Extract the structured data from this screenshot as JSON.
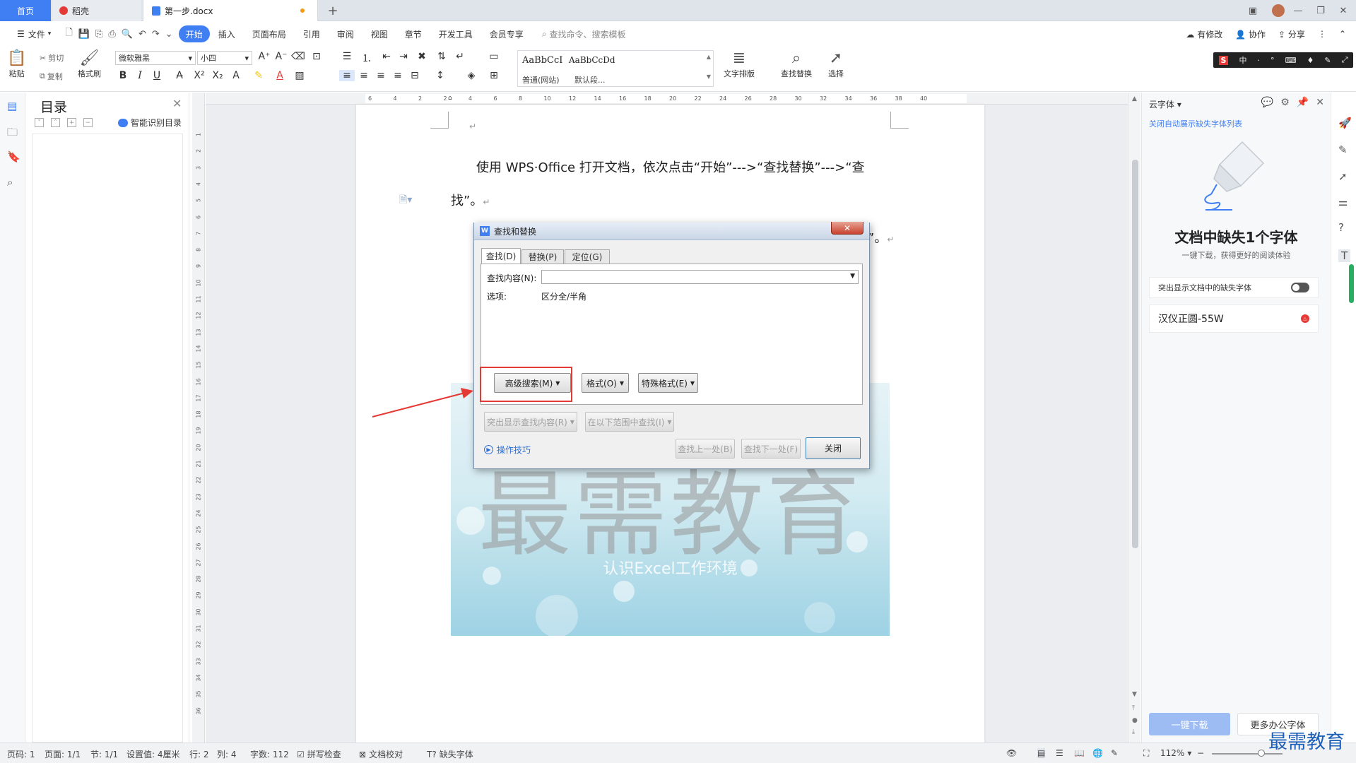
{
  "tabs": {
    "home": "首页",
    "daoke": "稻壳",
    "doc": "第一步.docx",
    "plus": "+",
    "close": "×"
  },
  "menu": {
    "file": "文件",
    "items": [
      "开始",
      "插入",
      "页面布局",
      "引用",
      "审阅",
      "视图",
      "章节",
      "开发工具",
      "会员专享"
    ],
    "search_placeholder": "查找命令、搜索模板",
    "right": [
      "有修改",
      "协作",
      "分享"
    ]
  },
  "ribbon": {
    "paste": "粘贴",
    "cut": "剪切",
    "copy": "复制",
    "format_painter": "格式刷",
    "font_name": "微软雅黑",
    "font_size": "小四",
    "style1_preview": "AaBbCcI",
    "style1_label": "普通(网站)",
    "style2_preview": "AaBbCcDd",
    "style2_label": "默认段...",
    "text_layout": "文字排版",
    "find_replace": "查找替换",
    "select": "选择",
    "ime": [
      "S",
      "中",
      "·",
      "°",
      "⌨",
      "♦",
      "✎",
      "⤢"
    ]
  },
  "toc": {
    "title": "目录",
    "smart": "智能识别目录"
  },
  "ruler": {
    "h_ticks": [
      "6",
      "4",
      "2",
      "2",
      "4",
      "6",
      "8",
      "10",
      "12",
      "14",
      "16",
      "18",
      "20",
      "22",
      "24",
      "26",
      "28",
      "30",
      "32",
      "34",
      "36",
      "38",
      "40"
    ],
    "v_ticks": [
      "1",
      "2",
      "3",
      "4",
      "5",
      "6",
      "7",
      "8",
      "9",
      "10",
      "11",
      "12",
      "13",
      "14",
      "15",
      "16",
      "17",
      "18",
      "19",
      "20",
      "21",
      "22",
      "23",
      "24",
      "25",
      "26",
      "27",
      "28",
      "29",
      "30",
      "31",
      "32",
      "33",
      "34",
      "35",
      "36"
    ]
  },
  "document": {
    "para1_line1": "使用 WPS·Office 打开文档，依次点击“开始”--->“查找替换”--->“查",
    "para1_line2": "找”。",
    "para2_tail": "部”。",
    "watermark": "最需教育",
    "image_subtitle": "认识Excel工作环境"
  },
  "dialog": {
    "title": "查找和替换",
    "tabs": [
      "查找(D)",
      "替换(P)",
      "定位(G)"
    ],
    "find_label": "查找内容(N):",
    "find_value": "",
    "options_label": "选项:",
    "options_value": "区分全/半角",
    "btn_advanced": "高级搜索(M)",
    "btn_format": "格式(O)",
    "btn_special": "特殊格式(E)",
    "btn_highlight": "突出显示查找内容(R)",
    "btn_in_range": "在以下范围中查找(I)",
    "tips": "操作技巧",
    "btn_prev": "查找上一处(B)",
    "btn_next": "查找下一处(F)",
    "btn_close": "关闭",
    "close_x": "✕"
  },
  "cloud_font": {
    "title": "云字体",
    "link": "关闭自动展示缺失字体列表",
    "heading": "文档中缺失1个字体",
    "subheading": "一键下载，获得更好的阅读体验",
    "toggle_label": "突出显示文档中的缺失字体",
    "font_item": "汉仪正圆-55W",
    "btn_download": "一键下载",
    "btn_more": "更多办公字体"
  },
  "status": {
    "page_num": "页码: 1",
    "pages": "页面: 1/1",
    "section": "节: 1/1",
    "setting": "设置值: 4厘米",
    "row": "行: 2",
    "col": "列: 4",
    "words": "字数: 112",
    "spell": "拼写检查",
    "proofread": "文档校对",
    "missing_font": "缺失字体",
    "zoom": "112%"
  },
  "brand": "最需教育",
  "colors": {
    "accent": "#3f7ef3",
    "highlight": "#e53935"
  }
}
